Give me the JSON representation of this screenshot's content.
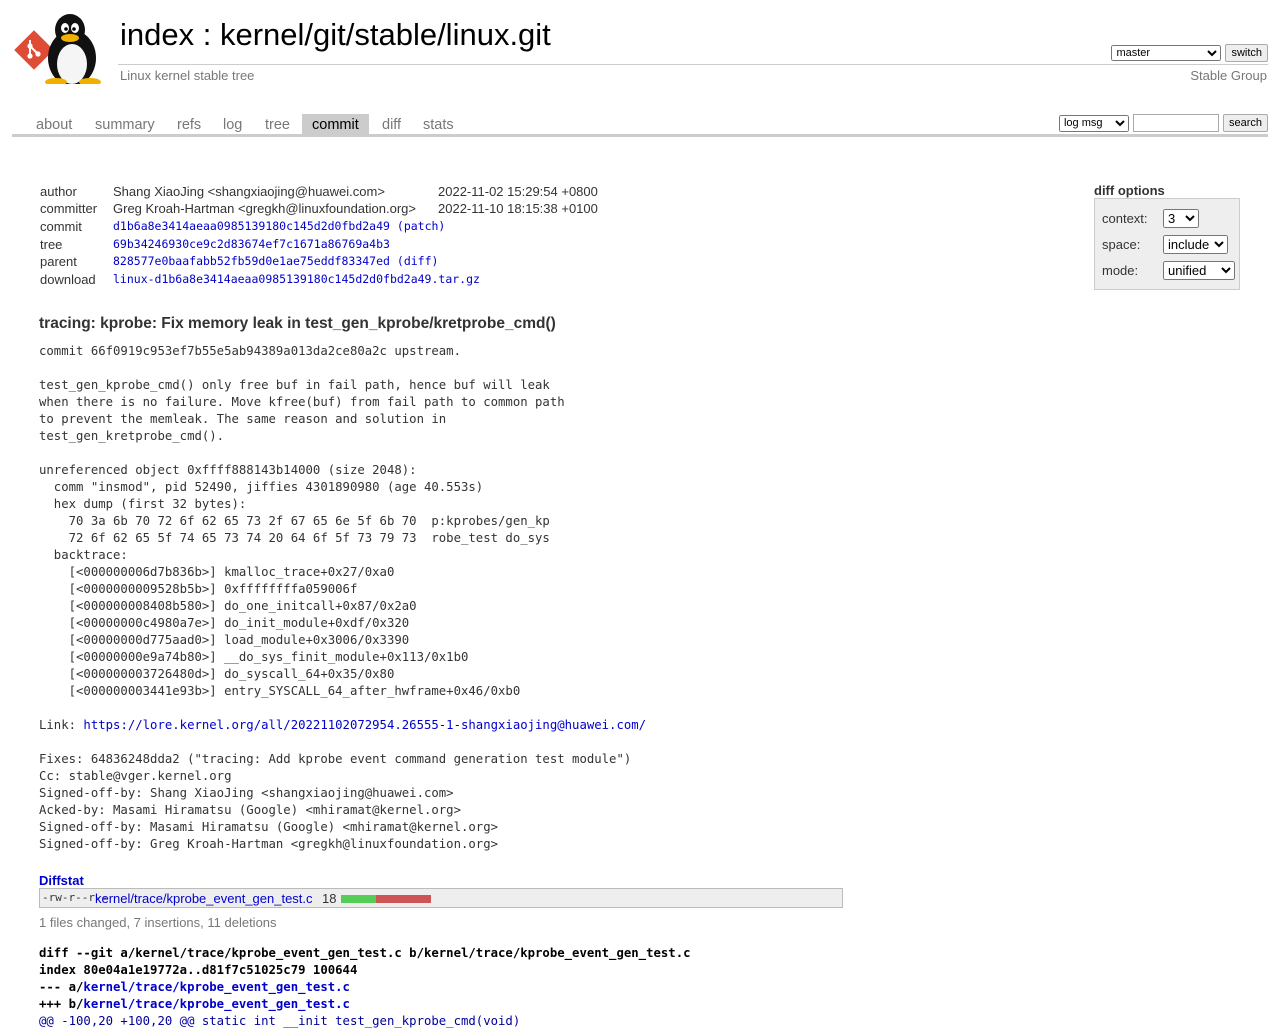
{
  "header": {
    "title_prefix": "index",
    "title_sep": " : ",
    "title_repo": "kernel/git/stable/linux.git",
    "description": "Linux kernel stable tree",
    "owner": "Stable Group",
    "branch_selected": "master",
    "switch_label": "switch"
  },
  "tabs": [
    {
      "label": "about",
      "active": false
    },
    {
      "label": "summary",
      "active": false
    },
    {
      "label": "refs",
      "active": false
    },
    {
      "label": "log",
      "active": false
    },
    {
      "label": "tree",
      "active": false
    },
    {
      "label": "commit",
      "active": true
    },
    {
      "label": "diff",
      "active": false
    },
    {
      "label": "stats",
      "active": false
    }
  ],
  "search": {
    "type_selected": "log msg",
    "query": "",
    "button_label": "search"
  },
  "commit_info": {
    "author_label": "author",
    "author": "Shang XiaoJing <shangxiaojing@huawei.com>",
    "author_date": "2022-11-02 15:29:54 +0800",
    "committer_label": "committer",
    "committer": "Greg Kroah-Hartman <gregkh@linuxfoundation.org>",
    "committer_date": "2022-11-10 18:15:38 +0100",
    "commit_label": "commit",
    "commit": "d1b6a8e3414aeaa0985139180c145d2d0fbd2a49",
    "commit_extra": "(patch)",
    "tree_label": "tree",
    "tree": "69b34246930ce9c2d83674ef7c1671a86769a4b3",
    "parent_label": "parent",
    "parent": "828577e0baafabb52fb59d0e1ae75eddf83347ed",
    "parent_extra": "(diff)",
    "download_label": "download",
    "download": "linux-d1b6a8e3414aeaa0985139180c145d2d0fbd2a49.tar.gz"
  },
  "diff_options": {
    "title": "diff options",
    "context_label": "context:",
    "context_value": "3",
    "space_label": "space:",
    "space_value": "include",
    "mode_label": "mode:",
    "mode_value": "unified"
  },
  "message": {
    "subject": "tracing: kprobe: Fix memory leak in test_gen_kprobe/kretprobe_cmd()",
    "body_before_link": "commit 66f0919c953ef7b55e5ab94389a013da2ce80a2c upstream.\n\ntest_gen_kprobe_cmd() only free buf in fail path, hence buf will leak\nwhen there is no failure. Move kfree(buf) from fail path to common path\nto prevent the memleak. The same reason and solution in\ntest_gen_kretprobe_cmd().\n\nunreferenced object 0xffff888143b14000 (size 2048):\n  comm \"insmod\", pid 52490, jiffies 4301890980 (age 40.553s)\n  hex dump (first 32 bytes):\n    70 3a 6b 70 72 6f 62 65 73 2f 67 65 6e 5f 6b 70  p:kprobes/gen_kp\n    72 6f 62 65 5f 74 65 73 74 20 64 6f 5f 73 79 73  robe_test do_sys\n  backtrace:\n    [<000000006d7b836b>] kmalloc_trace+0x27/0xa0\n    [<0000000009528b5b>] 0xffffffffa059006f\n    [<000000008408b580>] do_one_initcall+0x87/0x2a0\n    [<00000000c4980a7e>] do_init_module+0xdf/0x320\n    [<00000000d775aad0>] load_module+0x3006/0x3390\n    [<00000000e9a74b80>] __do_sys_finit_module+0x113/0x1b0\n    [<000000003726480d>] do_syscall_64+0x35/0x80\n    [<000000003441e93b>] entry_SYSCALL_64_after_hwframe+0x46/0xb0\n\n",
    "link_label": "Link: ",
    "link": "https://lore.kernel.org/all/20221102072954.26555-1-shangxiaojing@huawei.com/",
    "body_after_link": "\n\nFixes: 64836248dda2 (\"tracing: Add kprobe event command generation test module\")\nCc: stable@vger.kernel.org\nSigned-off-by: Shang XiaoJing <shangxiaojing@huawei.com>\nAcked-by: Masami Hiramatsu (Google) <mhiramat@kernel.org>\nSigned-off-by: Masami Hiramatsu (Google) <mhiramat@kernel.org>\nSigned-off-by: Greg Kroah-Hartman <gregkh@linuxfoundation.org>"
  },
  "diffstat": {
    "title": "Diffstat",
    "mode": "-rw-r--r--",
    "file": "kernel/trace/kprobe_event_gen_test.c",
    "count": "18",
    "insertions": 7,
    "deletions": 11,
    "summary": "1 files changed, 7 insertions, 11 deletions"
  },
  "diff": {
    "git_line": "diff --git a/kernel/trace/kprobe_event_gen_test.c b/kernel/trace/kprobe_event_gen_test.c",
    "index_line": "index 80e04a1e19772a..d81f7c51025c79 100644",
    "old_prefix": "--- a/",
    "new_prefix": "+++ b/",
    "file": "kernel/trace/kprobe_event_gen_test.c",
    "hunk": "@@ -100,20 +100,20 @@ static int __init test_gen_kprobe_cmd(void)"
  },
  "colors": {
    "link": "#0000cc",
    "insert_bar": "#55cc55",
    "delete_bar": "#cc5555",
    "tab_active_bg": "#cccccc"
  }
}
